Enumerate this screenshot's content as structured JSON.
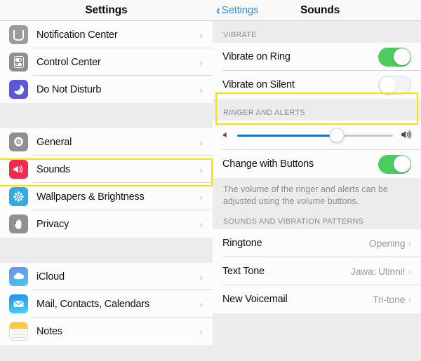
{
  "left": {
    "header_title": "Settings",
    "chevron": "›",
    "groups": [
      {
        "items": [
          {
            "label": "Notification Center",
            "icon": "notification-center-icon"
          },
          {
            "label": "Control Center",
            "icon": "control-center-icon"
          },
          {
            "label": "Do Not Disturb",
            "icon": "do-not-disturb-icon"
          }
        ]
      },
      {
        "items": [
          {
            "label": "General",
            "icon": "general-gear-icon"
          },
          {
            "label": "Sounds",
            "icon": "sounds-speaker-icon",
            "highlighted": true
          },
          {
            "label": "Wallpapers & Brightness",
            "icon": "wallpapers-icon"
          },
          {
            "label": "Privacy",
            "icon": "privacy-hand-icon"
          }
        ]
      },
      {
        "items": [
          {
            "label": "iCloud",
            "icon": "icloud-icon"
          },
          {
            "label": "Mail, Contacts, Calendars",
            "icon": "mail-icon"
          },
          {
            "label": "Notes",
            "icon": "notes-icon"
          }
        ]
      }
    ]
  },
  "right": {
    "back_label": "Settings",
    "back_chevron": "‹",
    "title": "Sounds",
    "chevron": "›",
    "sections": {
      "vibrate": {
        "header": "VIBRATE",
        "rows": [
          {
            "label": "Vibrate on Ring",
            "toggle": "on"
          },
          {
            "label": "Vibrate on Silent",
            "toggle": "off",
            "highlighted": true
          }
        ]
      },
      "ringer": {
        "header": "RINGER AND ALERTS",
        "slider": {
          "value_percent": 64,
          "low_icon": "speaker-low-icon",
          "high_icon": "speaker-high-icon"
        },
        "change_with_buttons": {
          "label": "Change with Buttons",
          "toggle": "on"
        },
        "footer": "The volume of the ringer and alerts can be adjusted using the volume buttons."
      },
      "patterns": {
        "header": "SOUNDS AND VIBRATION PATTERNS",
        "rows": [
          {
            "label": "Ringtone",
            "value": "Opening"
          },
          {
            "label": "Text Tone",
            "value": "Jawa: Utinni!"
          },
          {
            "label": "New Voicemail",
            "value": "Tri-tone"
          }
        ]
      }
    }
  },
  "colors": {
    "accent_blue": "#2f8fe8",
    "toggle_green": "#4ccb5f",
    "highlight_yellow": "#f2e500",
    "slider_blue": "#1873cc"
  }
}
